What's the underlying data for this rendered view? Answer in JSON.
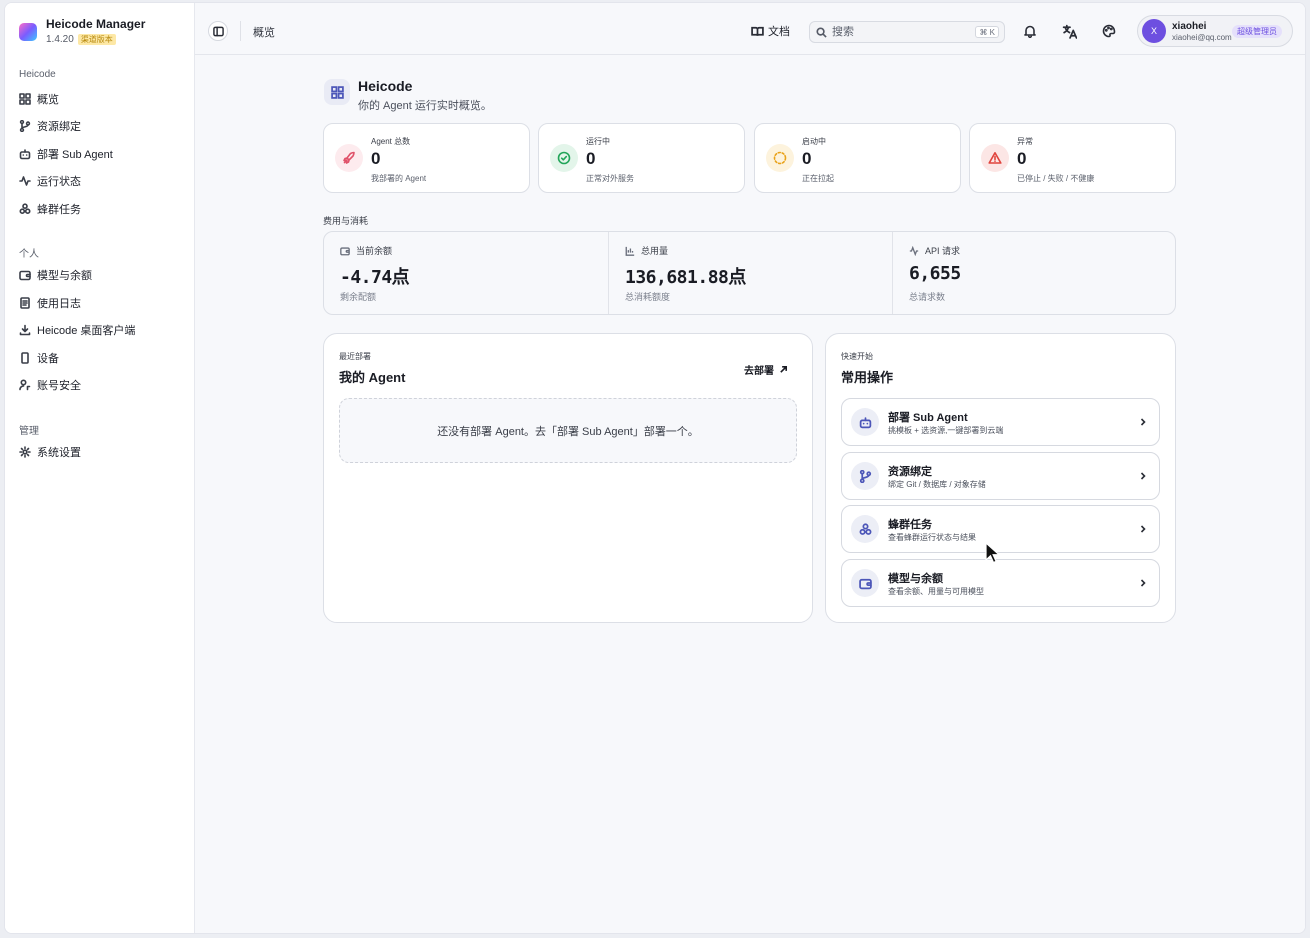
{
  "app": {
    "name": "Heicode Manager",
    "version": "1.4.20",
    "version_badge": "渠道版本"
  },
  "sidebar": {
    "sections": [
      {
        "label": "Heicode",
        "items": [
          {
            "label": "概览",
            "icon": "dashboard-icon"
          },
          {
            "label": "资源绑定",
            "icon": "git-branch-icon"
          },
          {
            "label": "部署 Sub Agent",
            "icon": "bot-icon"
          },
          {
            "label": "运行状态",
            "icon": "activity-icon"
          },
          {
            "label": "蜂群任务",
            "icon": "boxes-icon"
          }
        ]
      },
      {
        "label": "个人",
        "items": [
          {
            "label": "模型与余额",
            "icon": "wallet-icon"
          },
          {
            "label": "使用日志",
            "icon": "logs-icon"
          },
          {
            "label": "Heicode 桌面客户端",
            "icon": "download-icon"
          },
          {
            "label": "设备",
            "icon": "device-icon"
          },
          {
            "label": "账号安全",
            "icon": "user-key-icon"
          }
        ]
      },
      {
        "label": "管理",
        "items": [
          {
            "label": "系统设置",
            "icon": "gear-icon"
          }
        ]
      }
    ]
  },
  "topbar": {
    "breadcrumb": "概览",
    "docs_label": "文档",
    "search_placeholder": "搜索",
    "search_shortcut": "⌘ K",
    "user": {
      "initial": "X",
      "name": "xiaohei",
      "email": "xiaohei@qq.com",
      "role": "超级管理员"
    }
  },
  "page": {
    "title": "Heicode",
    "subtitle": "你的 Agent 运行实时概览。"
  },
  "stats": [
    {
      "label": "Agent 总数",
      "value": "0",
      "sub": "我部署的 Agent",
      "icon": "rocket-icon",
      "color": "#e0526a"
    },
    {
      "label": "运行中",
      "value": "0",
      "sub": "正常对外服务",
      "icon": "check-circle-icon",
      "color": "#22a559"
    },
    {
      "label": "启动中",
      "value": "0",
      "sub": "正在拉起",
      "icon": "loader-icon",
      "color": "#e9a21a"
    },
    {
      "label": "异常",
      "value": "0",
      "sub": "已停止 / 失败 / 不健康",
      "icon": "alert-triangle-icon",
      "color": "#e0443d"
    }
  ],
  "costs": {
    "section_label": "费用与消耗",
    "items": [
      {
        "label": "当前余额",
        "value": "-4.74点",
        "sub": "剩余配额",
        "icon": "wallet-icon"
      },
      {
        "label": "总用量",
        "value": "136,681.88点",
        "sub": "总消耗额度",
        "icon": "bar-chart-icon"
      },
      {
        "label": "API 请求",
        "value": "6,655",
        "sub": "总请求数",
        "icon": "activity-icon"
      }
    ]
  },
  "recent": {
    "kicker": "最近部署",
    "title": "我的 Agent",
    "action": "去部署",
    "empty": "还没有部署 Agent。去「部署 Sub Agent」部署一个。"
  },
  "quick": {
    "kicker": "快速开始",
    "title": "常用操作",
    "items": [
      {
        "title": "部署 Sub Agent",
        "sub": "挑模板 + 选资源,一键部署到云端",
        "icon": "bot-icon"
      },
      {
        "title": "资源绑定",
        "sub": "绑定 Git / 数据库 / 对象存储",
        "icon": "git-branch-icon"
      },
      {
        "title": "蜂群任务",
        "sub": "查看蜂群运行状态与结果",
        "icon": "boxes-icon"
      },
      {
        "title": "模型与余额",
        "sub": "查看余额、用量与可用模型",
        "icon": "wallet-icon"
      }
    ]
  }
}
